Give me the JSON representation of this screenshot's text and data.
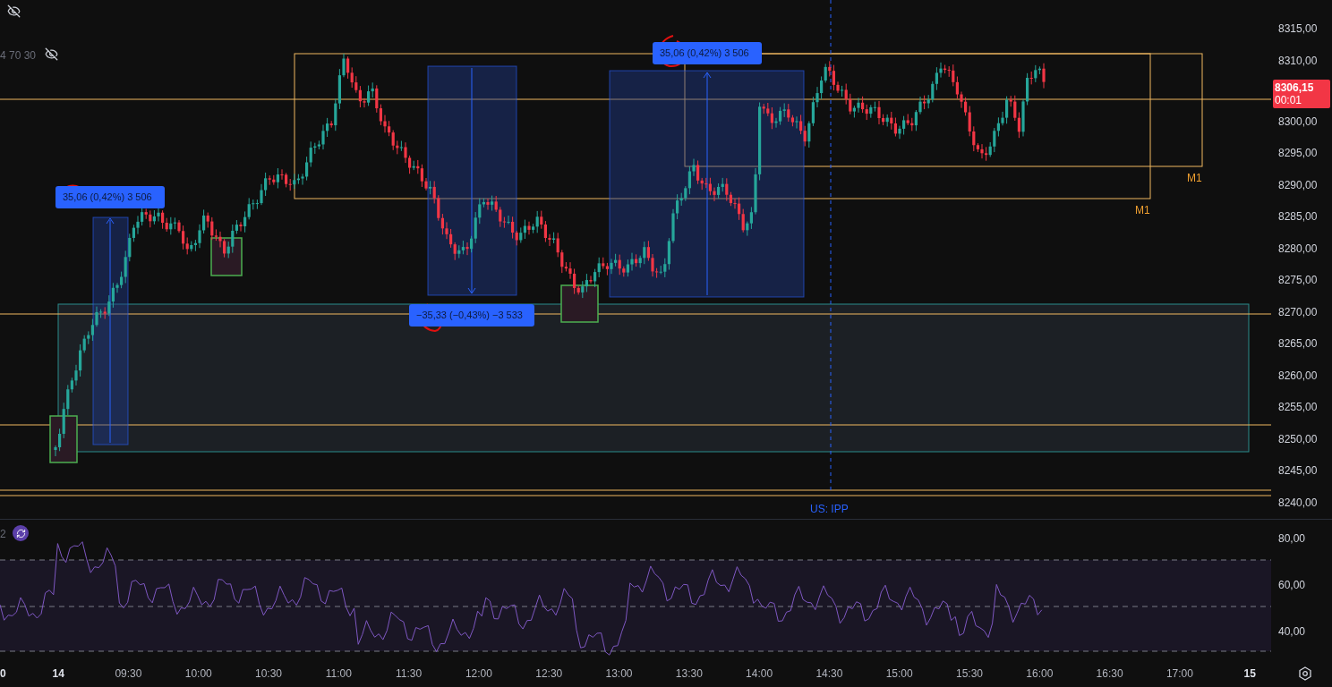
{
  "legend": {
    "params": "4 70 30"
  },
  "measure_labels": [
    {
      "text": "35,06 (0,42%) 3 506"
    },
    {
      "text": "−35,33 (−0,43%) −3 533"
    },
    {
      "text": "35,06 (0,42%) 3 506"
    }
  ],
  "zone_labels": [
    "M1",
    "M1"
  ],
  "event_label": "US: IPP",
  "price_axis": {
    "ticks": [
      "8315,00",
      "8310,00",
      "8300,00",
      "8295,00",
      "8290,00",
      "8285,00",
      "8280,00",
      "8275,00",
      "8270,00",
      "8265,00",
      "8260,00",
      "8255,00",
      "8250,00",
      "8245,00",
      "8240,00"
    ],
    "last_price": "8306,15",
    "countdown": "00:01"
  },
  "rsi": {
    "legend": "2",
    "ticks": [
      "80,00",
      "60,00",
      "40,00"
    ]
  },
  "time_axis": [
    {
      "label": "0",
      "kind": "day"
    },
    {
      "label": "14",
      "kind": "day"
    },
    {
      "label": "09:30",
      "kind": "time"
    },
    {
      "label": "10:00",
      "kind": "time"
    },
    {
      "label": "10:30",
      "kind": "time"
    },
    {
      "label": "11:00",
      "kind": "time"
    },
    {
      "label": "11:30",
      "kind": "time"
    },
    {
      "label": "12:00",
      "kind": "time"
    },
    {
      "label": "12:30",
      "kind": "time"
    },
    {
      "label": "13:00",
      "kind": "time"
    },
    {
      "label": "13:30",
      "kind": "time"
    },
    {
      "label": "14:00",
      "kind": "time"
    },
    {
      "label": "14:30",
      "kind": "time"
    },
    {
      "label": "15:00",
      "kind": "time"
    },
    {
      "label": "15:30",
      "kind": "time"
    },
    {
      "label": "16:00",
      "kind": "time"
    },
    {
      "label": "16:30",
      "kind": "time"
    },
    {
      "label": "17:00",
      "kind": "time"
    },
    {
      "label": "15",
      "kind": "day"
    }
  ]
}
